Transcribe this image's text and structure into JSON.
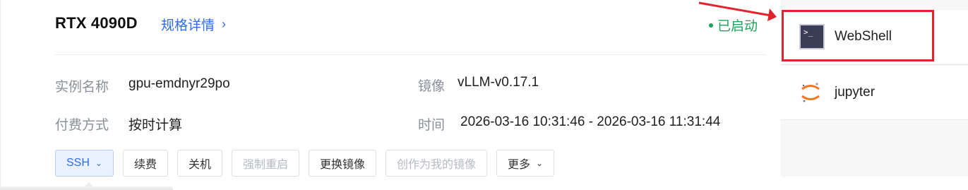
{
  "instance": {
    "gpu_model": "RTX 4090D",
    "spec_link": "规格详情",
    "status": "已启动",
    "fields": {
      "name_label": "实例名称",
      "name_value": "gpu-emdnyr29po",
      "image_label": "镜像",
      "image_value": "vLLM-v0.17.1",
      "billing_label": "付费方式",
      "billing_value": "按时计算",
      "time_label": "时间",
      "time_value": "2026-03-16 10:31:46 - 2026-03-16 11:31:44"
    }
  },
  "toolbar": {
    "ssh": "SSH",
    "renew": "续费",
    "shutdown": "关机",
    "force_restart": "强制重启",
    "change_image": "更换镜像",
    "create_image": "创作为我的镜像",
    "more": "更多"
  },
  "dropdown": {
    "items": [
      {
        "label": "WebShell",
        "icon": "terminal-icon"
      },
      {
        "label": "jupyter",
        "icon": "jupyter-icon"
      }
    ]
  },
  "colors": {
    "accent": "#2f6de6",
    "status_green": "#1aa35a",
    "annotation_red": "#e0232e"
  }
}
